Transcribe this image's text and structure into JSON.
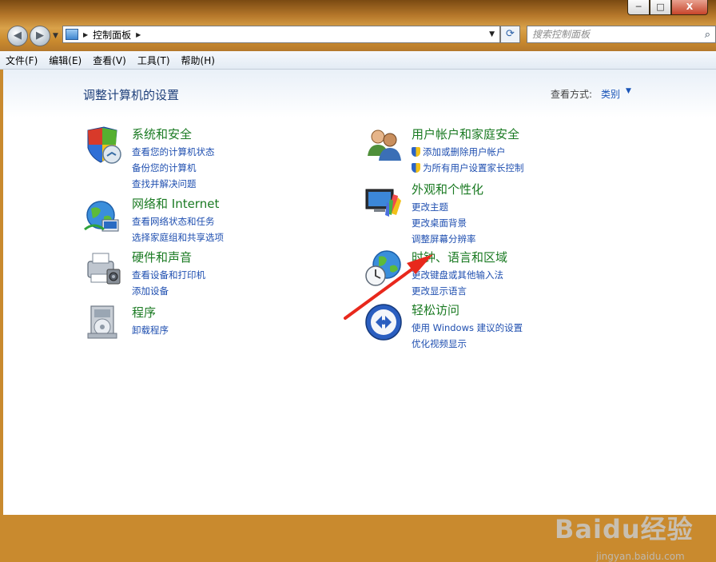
{
  "window": {
    "buttons": {
      "minimize": "─",
      "maximize": "□",
      "close": "X"
    }
  },
  "nav": {
    "back_icon": "back-arrow-icon",
    "forward_icon": "forward-arrow-icon",
    "address": "控制面板",
    "search_placeholder": "搜索控制面板"
  },
  "menu": [
    "文件(F)",
    "编辑(E)",
    "查看(V)",
    "工具(T)",
    "帮助(H)"
  ],
  "page": {
    "title": "调整计算机的设置",
    "view_label": "查看方式:",
    "view_value": "类别"
  },
  "categories": [
    {
      "title": "系统和安全",
      "icon": "shield-icon",
      "links": [
        "查看您的计算机状态",
        "备份您的计算机",
        "查找并解决问题"
      ]
    },
    {
      "title": "网络和 Internet",
      "icon": "network-globe-icon",
      "links": [
        "查看网络状态和任务",
        "选择家庭组和共享选项"
      ]
    },
    {
      "title": "硬件和声音",
      "icon": "printer-icon",
      "links": [
        "查看设备和打印机",
        "添加设备"
      ]
    },
    {
      "title": "程序",
      "icon": "programs-icon",
      "links": [
        "卸载程序"
      ]
    },
    {
      "title": "用户帐户和家庭安全",
      "icon": "users-icon",
      "links": [
        "添加或删除用户帐户",
        "为所有用户设置家长控制"
      ]
    },
    {
      "title": "外观和个性化",
      "icon": "appearance-icon",
      "links": [
        "更改主题",
        "更改桌面背景",
        "调整屏幕分辨率"
      ]
    },
    {
      "title": "时钟、语言和区域",
      "icon": "clock-globe-icon",
      "links": [
        "更改键盘或其他输入法",
        "更改显示语言"
      ]
    },
    {
      "title": "轻松访问",
      "icon": "ease-of-access-icon",
      "links": [
        "使用 Windows 建议的设置",
        "优化视频显示"
      ]
    }
  ],
  "watermark": {
    "brand": "Baidu经验",
    "url": "jingyan.baidu.com"
  },
  "colors": {
    "category_title": "#1a7a22",
    "link": "#1f4fb0",
    "annotation_arrow": "#e8281c"
  }
}
